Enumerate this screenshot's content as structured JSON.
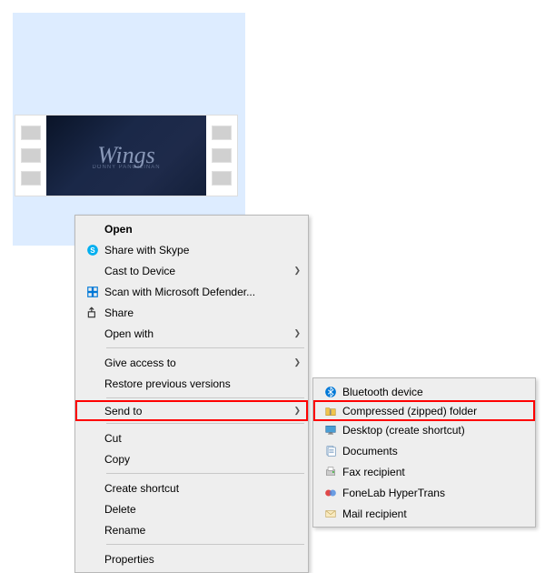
{
  "file": {
    "video_title": "Wings",
    "video_artist": "DONNY PANGILINAN"
  },
  "main_menu": {
    "open": "Open",
    "share_skype": "Share with Skype",
    "cast": "Cast to Device",
    "defender": "Scan with Microsoft Defender...",
    "share": "Share",
    "open_with": "Open with",
    "give_access": "Give access to",
    "restore": "Restore previous versions",
    "send_to": "Send to",
    "cut": "Cut",
    "copy": "Copy",
    "shortcut": "Create shortcut",
    "delete": "Delete",
    "rename": "Rename",
    "properties": "Properties"
  },
  "sub_menu": {
    "bluetooth": "Bluetooth device",
    "compressed": "Compressed (zipped) folder",
    "desktop": "Desktop (create shortcut)",
    "documents": "Documents",
    "fax": "Fax recipient",
    "fonelab": "FoneLab HyperTrans",
    "mail": "Mail recipient"
  }
}
